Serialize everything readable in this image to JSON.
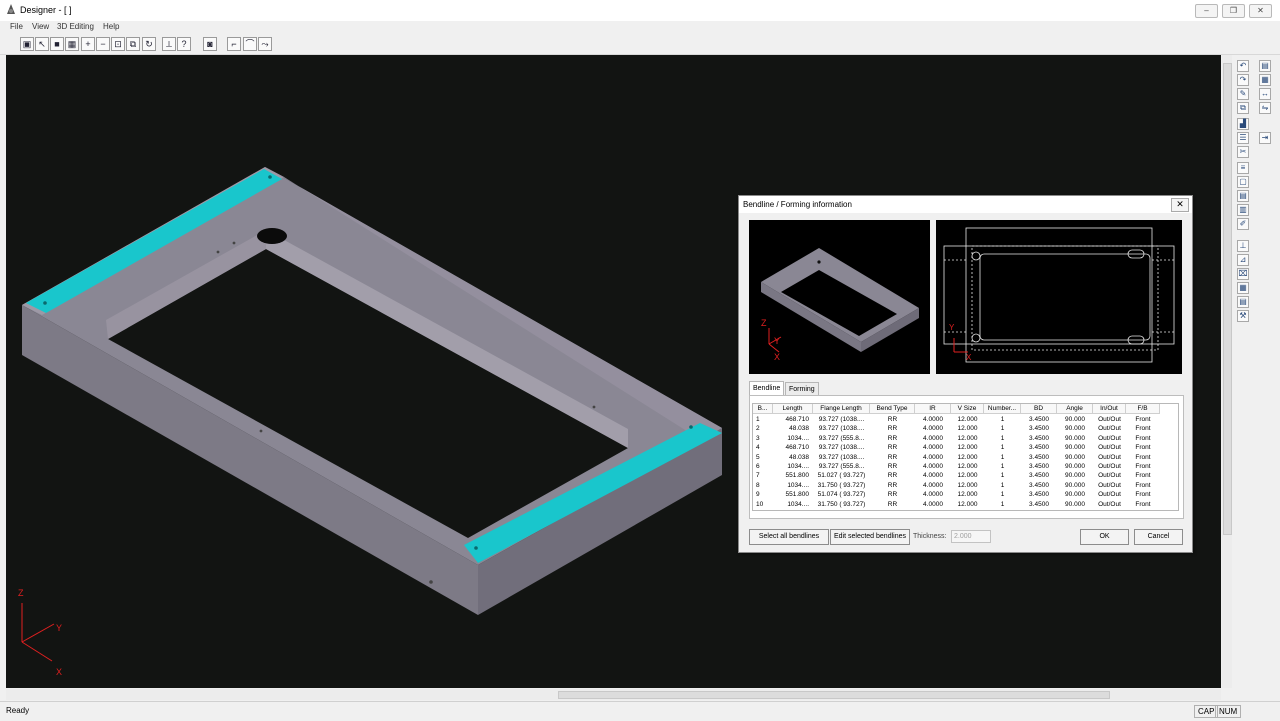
{
  "app": {
    "title": "Designer - [ ]"
  },
  "menu": [
    "File",
    "View",
    "3D Editing",
    "Help"
  ],
  "window_controls": [
    "minimize",
    "restore",
    "close"
  ],
  "toolbar_icons": [
    "box-view-icon",
    "select-arrow-icon",
    "save-icon",
    "grid-icon",
    "zoom-in-icon",
    "zoom-out-icon",
    "zoom-extents-icon",
    "zoom-window-icon",
    "rotate-icon",
    "measure-icon",
    "help-query-icon",
    "camera-icon",
    "flange-tool-icon",
    "bend-tool-icon",
    "unfold-tool-icon"
  ],
  "viewport": {
    "bg_color": "#121412",
    "part_color": "#8e8a96",
    "highlight_color": "#00c8c8",
    "axes": {
      "z": "Z",
      "y": "Y",
      "x": "X"
    }
  },
  "dialog": {
    "title": "Bendline / Forming information",
    "close": "✕",
    "preview_axes": {
      "z": "Z",
      "y": "Y",
      "x": "X"
    },
    "tabs": [
      "Bendline",
      "Forming"
    ],
    "active_tab": "Bendline",
    "columns": [
      "B...",
      "Length",
      "Flange Length",
      "Bend Type",
      "IR",
      "V Size",
      "Number...",
      "BD",
      "Angle",
      "In/Out",
      "F/B"
    ],
    "rows": [
      [
        "1",
        "468.710",
        "93.727 (1038....",
        "RR",
        "4.0000",
        "12.000",
        "1",
        "3.4500",
        "90.000",
        "Out/Out",
        "Front"
      ],
      [
        "2",
        "48.038",
        "93.727 (1038....",
        "RR",
        "4.0000",
        "12.000",
        "1",
        "3.4500",
        "90.000",
        "Out/Out",
        "Front"
      ],
      [
        "3",
        "1034....",
        "93.727 (555.8...",
        "RR",
        "4.0000",
        "12.000",
        "1",
        "3.4500",
        "90.000",
        "Out/Out",
        "Front"
      ],
      [
        "4",
        "468.710",
        "93.727 (1038....",
        "RR",
        "4.0000",
        "12.000",
        "1",
        "3.4500",
        "90.000",
        "Out/Out",
        "Front"
      ],
      [
        "5",
        "48.038",
        "93.727 (1038....",
        "RR",
        "4.0000",
        "12.000",
        "1",
        "3.4500",
        "90.000",
        "Out/Out",
        "Front"
      ],
      [
        "6",
        "1034....",
        "93.727 (555.8...",
        "RR",
        "4.0000",
        "12.000",
        "1",
        "3.4500",
        "90.000",
        "Out/Out",
        "Front"
      ],
      [
        "7",
        "551.800",
        "51.027 ( 93.727)",
        "RR",
        "4.0000",
        "12.000",
        "1",
        "3.4500",
        "90.000",
        "Out/Out",
        "Front"
      ],
      [
        "8",
        "1034....",
        "31.750 ( 93.727)",
        "RR",
        "4.0000",
        "12.000",
        "1",
        "3.4500",
        "90.000",
        "Out/Out",
        "Front"
      ],
      [
        "9",
        "551.800",
        "51.074 ( 93.727)",
        "RR",
        "4.0000",
        "12.000",
        "1",
        "3.4500",
        "90.000",
        "Out/Out",
        "Front"
      ],
      [
        "10",
        "1034....",
        "31.750 ( 93.727)",
        "RR",
        "4.0000",
        "12.000",
        "1",
        "3.4500",
        "90.000",
        "Out/Out",
        "Front"
      ]
    ],
    "select_all_label": "Select all bendlines",
    "edit_selected_label": "Edit selected bendlines",
    "thickness_label": "Thickness:",
    "thickness_value": "2.000",
    "ok_label": "OK",
    "cancel_label": "Cancel"
  },
  "status": {
    "text": "Ready",
    "caps": "CAP",
    "num": "NUM"
  }
}
